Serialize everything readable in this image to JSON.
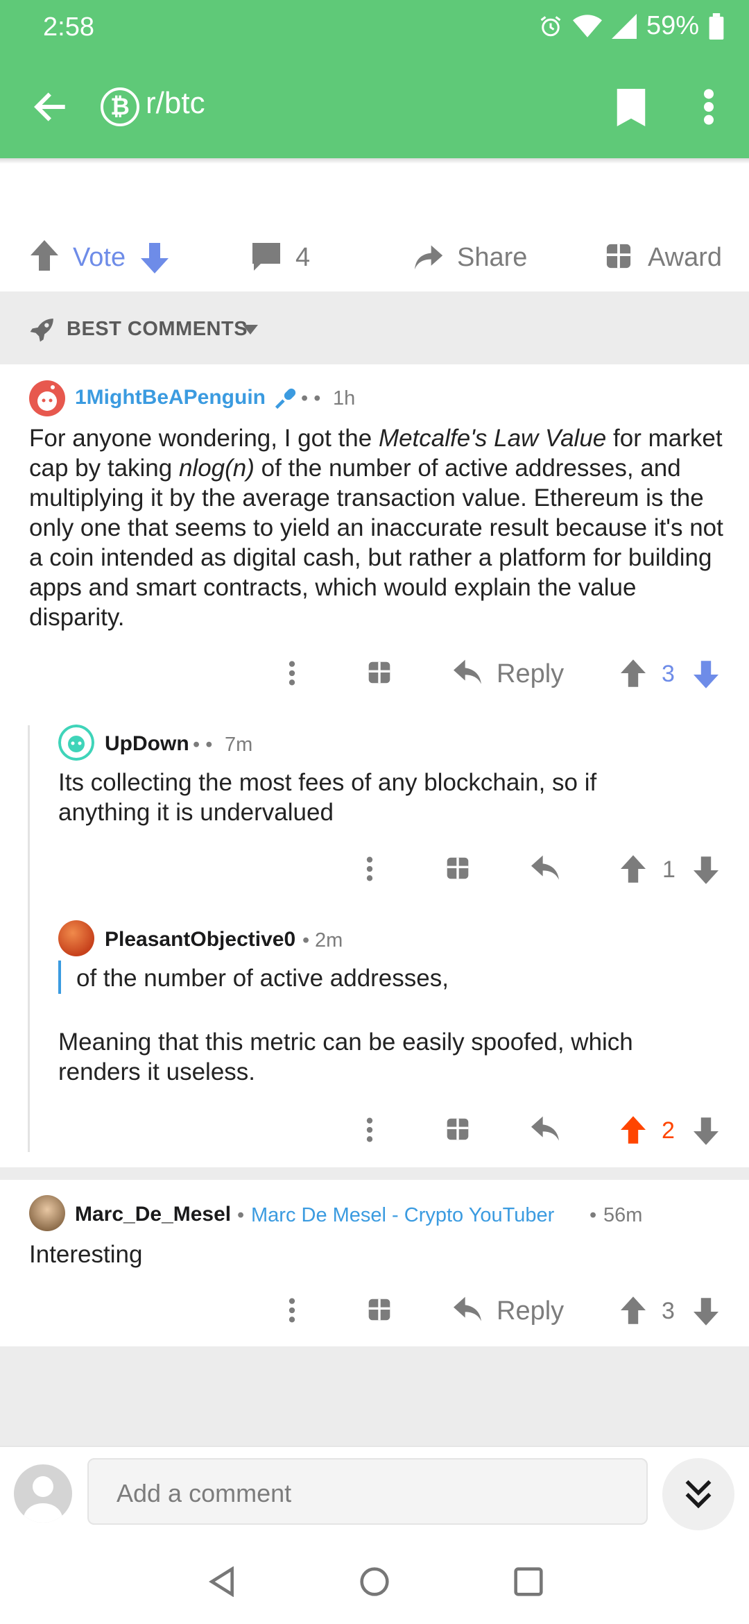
{
  "status": {
    "time": "2:58",
    "battery": "59%"
  },
  "header": {
    "subreddit": "r/btc",
    "subreddit_icon": "₿"
  },
  "actions": {
    "vote_label": "Vote",
    "comment_count": "4",
    "share_label": "Share",
    "award_label": "Award"
  },
  "sort": {
    "label": "BEST COMMENTS"
  },
  "comments": [
    {
      "author": "1MightBeAPenguin",
      "time": "1h",
      "body_parts": [
        "For anyone wondering, I got the ",
        "Metcalfe's Law Value",
        " for market cap by taking ",
        "nlog(n)",
        " of the number of active addresses, and multiplying it by the average transaction value. Ethereum is the only one that seems to yield an inaccurate result because it's not a coin intended as digital cash, but rather a platform for building apps and smart contracts, which would explain the value disparity."
      ],
      "reply_label": "Reply",
      "score": "3",
      "replies": [
        {
          "author": "UpDown",
          "time": "7m",
          "body": "Its collecting the most fees of any blockchain, so if anything it is undervalued",
          "score": "1"
        },
        {
          "author": "PleasantObjective0",
          "time": "2m",
          "quote": "of the number of active addresses,",
          "body": "Meaning that this metric can be easily spoofed, which renders it useless.",
          "score": "2"
        }
      ]
    },
    {
      "author": "Marc_De_Mesel",
      "flair": "Marc De Mesel - Crypto YouTuber",
      "time": "56m",
      "body": "Interesting",
      "reply_label": "Reply",
      "score": "3"
    }
  ],
  "composer": {
    "placeholder": "Add a comment"
  },
  "colors": {
    "header_green": "#5fc978",
    "vote_blue": "#6e8ce8",
    "upvote_orange": "#ff4500",
    "link_blue": "#3b9be0"
  }
}
